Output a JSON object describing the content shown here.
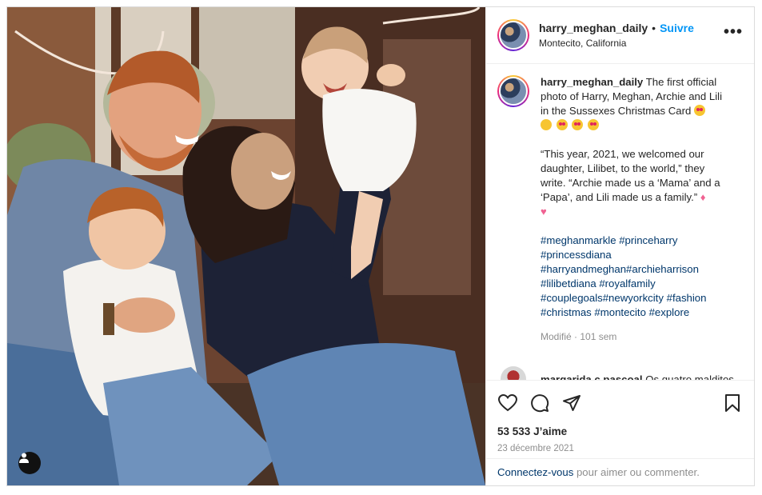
{
  "post": {
    "username": "harry_meghan_daily",
    "follow_label": "Suivre",
    "separator": "•",
    "location": "Montecito, California",
    "more_label": "•••"
  },
  "caption": {
    "username": "harry_meghan_daily",
    "text": "The first official photo of Harry, Meghan, Archie and Lili in the Sussexes Christmas Card",
    "quote": "“This year, 2021, we welcomed our daughter, Lilibet, to the world,” they write. “Archie made us a ‘Mama’ and a ‘Papa’, and Lili made us a family.”",
    "hashtags": "#meghanmarkle #princeharry #princessdiana #harryandmeghan#archieharrison #lilibetdiana #royalfamily #couplegoals#newyorkcity #fashion #christmas #montecito #explore",
    "meta": "Modifié · 101 sem"
  },
  "comment": {
    "username": "margarida.c.pascoal",
    "text": "Os quatro malditos."
  },
  "stats": {
    "likes_count": "53 533",
    "likes_label": "J’aime",
    "date": "23 décembre 2021"
  },
  "footer": {
    "login_link": "Connectez-vous",
    "rest": " pour aimer ou commenter."
  },
  "icons": {
    "like": "heart-icon",
    "comment": "comment-icon",
    "share": "share-icon",
    "save": "bookmark-icon",
    "user_tag": "user-tag-icon"
  },
  "colors": {
    "link_blue": "#0095f6",
    "hashtag": "#00376b",
    "muted": "#8e8e8e"
  }
}
